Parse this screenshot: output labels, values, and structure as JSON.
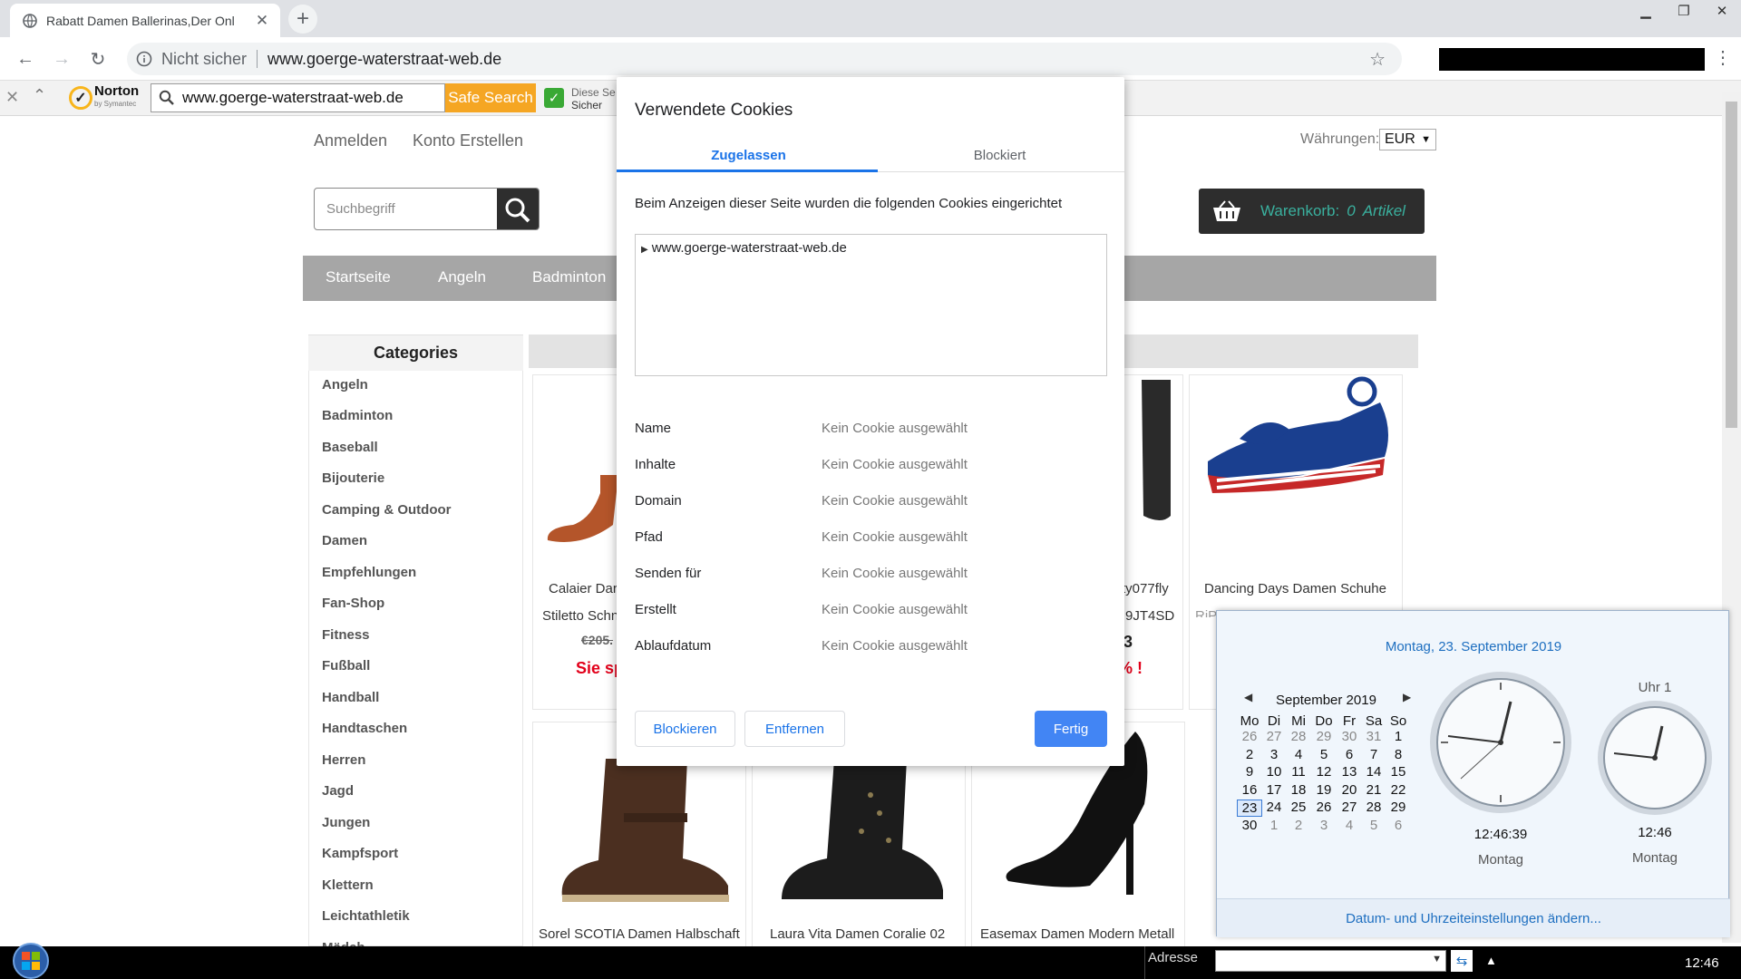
{
  "browser": {
    "tab_title": "Rabatt Damen Ballerinas,Der Onl",
    "not_secure_label": "Nicht sicher",
    "url": "www.goerge-waterstraat-web.de"
  },
  "norton": {
    "logo_text": "Norton",
    "logo_sub": "by Symantec",
    "search_value": "www.goerge-waterstraat-web.de",
    "safe_search_label": "Safe Search",
    "status_line1": "Diese Se",
    "status_line2": "Sicher"
  },
  "site": {
    "login": "Anmelden",
    "register": "Konto Erstellen",
    "currency_label": "Währungen:",
    "currency_value": "EUR",
    "search_placeholder": "Suchbegriff",
    "cart_label": "Warenkorb:",
    "cart_count": "0",
    "cart_unit": "Artikel",
    "nav": [
      "Startseite",
      "Angeln",
      "Badminton"
    ],
    "categories_title": "Categories",
    "categories": [
      "Angeln",
      "Badminton",
      "Baseball",
      "Bijouterie",
      "Camping & Outdoor",
      "Damen",
      "Empfehlungen",
      "Fan-Shop",
      "Fitness",
      "Fußball",
      "Handball",
      "Handtaschen",
      "Herren",
      "Jagd",
      "Jungen",
      "Kampfsport",
      "Klettern",
      "Leichtathletik",
      "Mädch"
    ],
    "products": [
      {
        "name1": "Calaier Dar",
        "name2": "Stiletto Schn",
        "price_old": "€205.",
        "save": "Sie sp"
      },
      {
        "name1": "ty077fly",
        "name2": "9JT4SD",
        "price_frag": "3",
        "save": "% !"
      },
      {
        "name1": "Dancing Days Damen Schuhe",
        "name2": "RiPtiNep Dk. Dt. Vdr"
      },
      {
        "name1": "Sorel SCOTIA Damen Halbschaft"
      },
      {
        "name1": "Laura Vita Damen Coralie 02"
      },
      {
        "name1": "Easemax Damen Modern Metall"
      }
    ]
  },
  "cookies": {
    "title": "Verwendete Cookies",
    "tab_allowed": "Zugelassen",
    "tab_blocked": "Blockiert",
    "description": "Beim Anzeigen dieser Seite wurden die folgenden Cookies eingerichtet",
    "tree_node": "www.goerge-waterstraat-web.de",
    "fields": [
      {
        "label": "Name",
        "value": "Kein Cookie ausgewählt"
      },
      {
        "label": "Inhalte",
        "value": "Kein Cookie ausgewählt"
      },
      {
        "label": "Domain",
        "value": "Kein Cookie ausgewählt"
      },
      {
        "label": "Pfad",
        "value": "Kein Cookie ausgewählt"
      },
      {
        "label": "Senden für",
        "value": "Kein Cookie ausgewählt"
      },
      {
        "label": "Erstellt",
        "value": "Kein Cookie ausgewählt"
      },
      {
        "label": "Ablaufdatum",
        "value": "Kein Cookie ausgewählt"
      }
    ],
    "btn_block": "Blockieren",
    "btn_remove": "Entfernen",
    "btn_done": "Fertig"
  },
  "calendar": {
    "full_date": "Montag, 23. September 2019",
    "month": "September 2019",
    "weekdays": [
      "Mo",
      "Di",
      "Mi",
      "Do",
      "Fr",
      "Sa",
      "So"
    ],
    "weeks": [
      [
        "26",
        "27",
        "28",
        "29",
        "30",
        "31",
        "1"
      ],
      [
        "2",
        "3",
        "4",
        "5",
        "6",
        "7",
        "8"
      ],
      [
        "9",
        "10",
        "11",
        "12",
        "13",
        "14",
        "15"
      ],
      [
        "16",
        "17",
        "18",
        "19",
        "20",
        "21",
        "22"
      ],
      [
        "23",
        "24",
        "25",
        "26",
        "27",
        "28",
        "29"
      ],
      [
        "30",
        "1",
        "2",
        "3",
        "4",
        "5",
        "6"
      ]
    ],
    "today": "23",
    "clock1_time": "12:46:39",
    "clock1_day": "Montag",
    "clock2_title": "Uhr 1",
    "clock2_time": "12:46",
    "clock2_day": "Montag",
    "settings_link": "Datum- und Uhrzeiteinstellungen ändern..."
  },
  "taskbar": {
    "address_label": "Adresse",
    "time": "12:46"
  },
  "colors": {
    "accent_blue": "#1a73e8",
    "safe_search_orange": "#f5a623",
    "sale_red": "#e2001a",
    "cart_teal": "#3ab09e"
  }
}
